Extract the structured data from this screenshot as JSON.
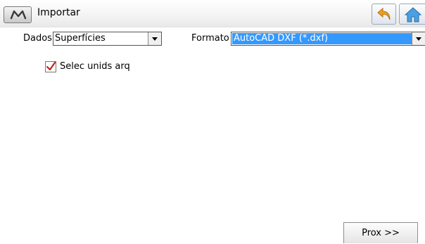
{
  "header": {
    "title": "Importar",
    "menu_icon": "m-logo-icon",
    "back_icon": "back-arrow-icon",
    "home_icon": "home-icon"
  },
  "form": {
    "dados_label": "Dados",
    "dados_value": "Superfícies",
    "formato_label": "Formato",
    "formato_value": "AutoCAD DXF (*.dxf)",
    "checkbox_label": "Selec unids arq",
    "checkbox_checked": true
  },
  "footer": {
    "next_label": "Prox >>"
  },
  "colors": {
    "selection": "#3399ff",
    "check": "#b5281f",
    "back_arrow": "#f0a020",
    "home": "#4aa0e0"
  }
}
